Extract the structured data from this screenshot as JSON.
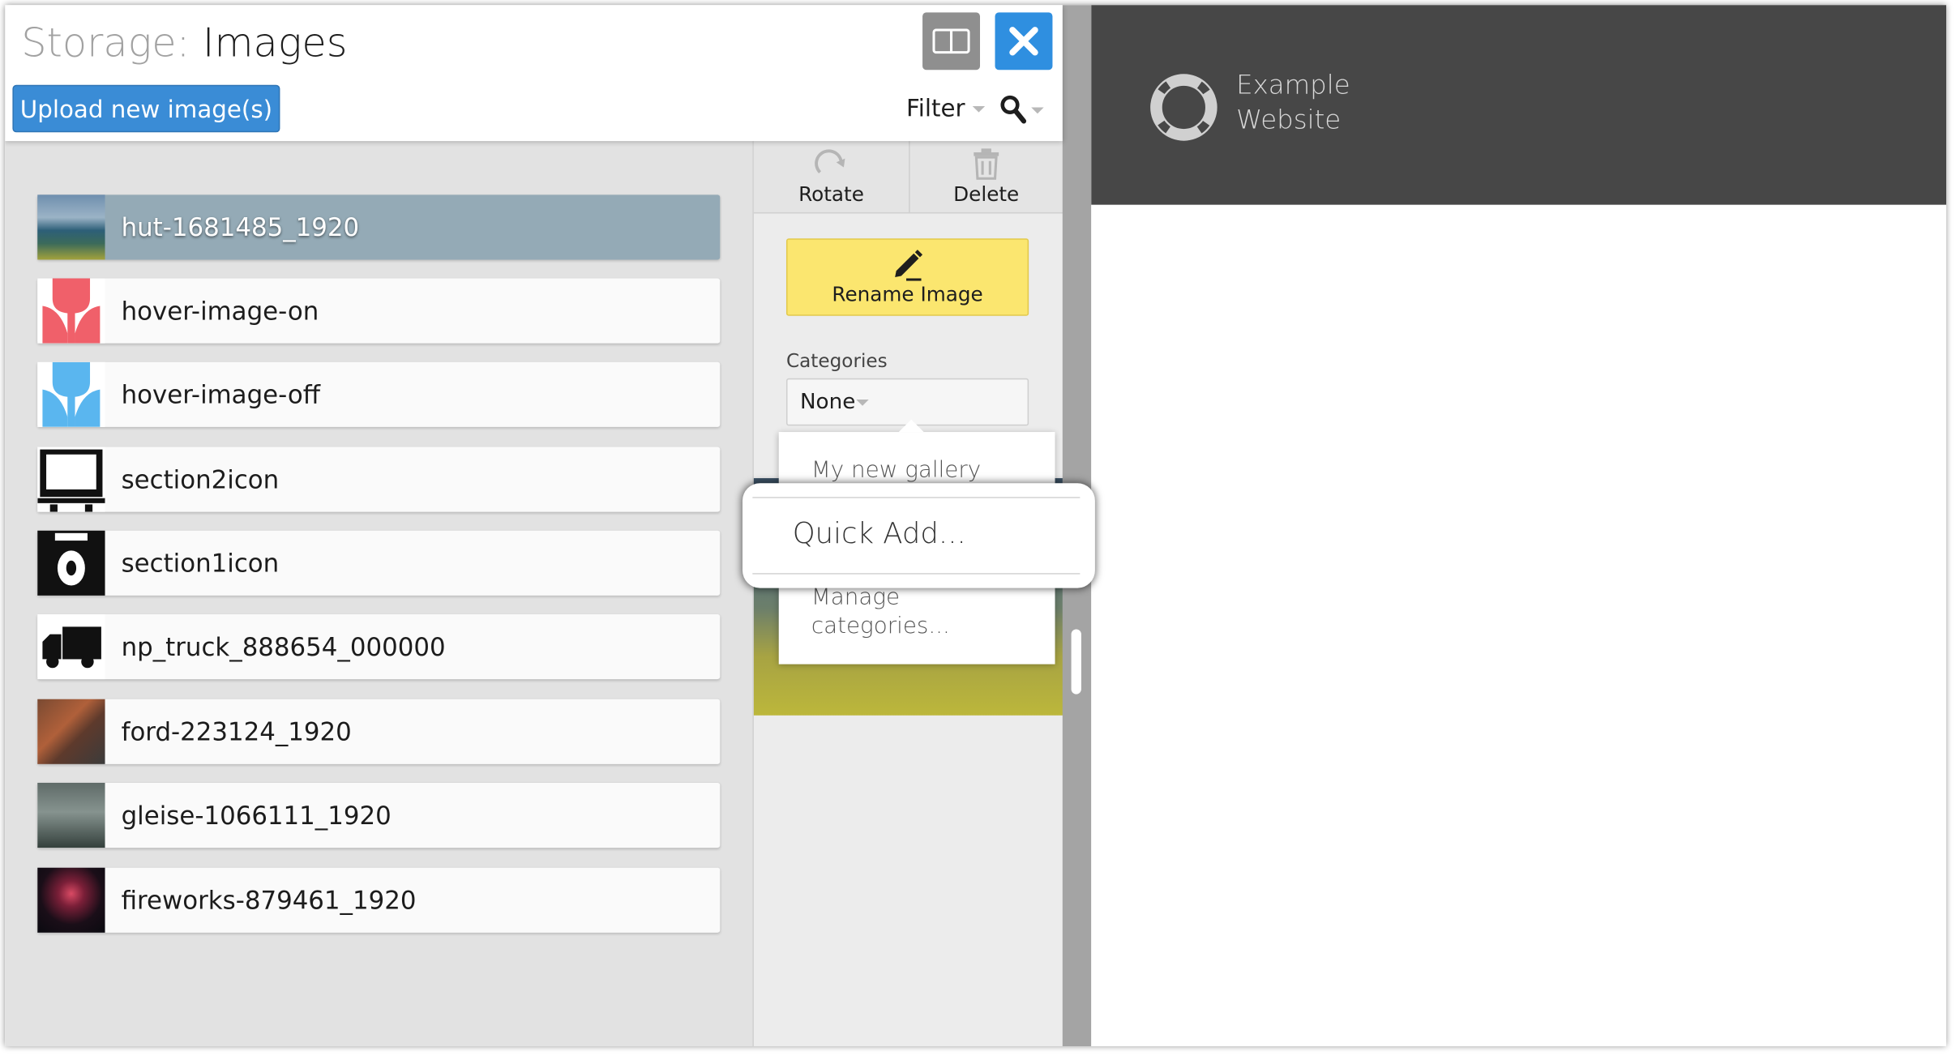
{
  "header": {
    "title_prefix": "Storage:",
    "title": "Images",
    "upload_label": "Upload new image(s)",
    "filter_label": "Filter"
  },
  "images": [
    {
      "name": "hut-1681485_1920",
      "selected": true
    },
    {
      "name": "hover-image-on",
      "selected": false
    },
    {
      "name": "hover-image-off",
      "selected": false
    },
    {
      "name": "section2icon",
      "selected": false
    },
    {
      "name": "section1icon",
      "selected": false
    },
    {
      "name": "np_truck_888654_000000",
      "selected": false
    },
    {
      "name": "ford-223124_1920",
      "selected": false
    },
    {
      "name": "gleise-1066111_1920",
      "selected": false
    },
    {
      "name": "fireworks-879461_1920",
      "selected": false
    }
  ],
  "tools": {
    "rotate_label": "Rotate",
    "delete_label": "Delete",
    "rename_label": "Rename Image",
    "categories_label": "Categories",
    "category_value": "None"
  },
  "category_menu": {
    "items": [
      "My new gallery",
      "Quick Add...",
      "Manage categories..."
    ],
    "manage_line1": "Manage",
    "manage_line2": "categories..."
  },
  "site": {
    "name_line1": "Example",
    "name_line2": "Website"
  },
  "colors": {
    "upload_button": "#3a8cd6",
    "close_button": "#2f8fe0",
    "rename_button": "#fbe66f",
    "selected_row": "#94aab6",
    "site_header": "#474747"
  }
}
